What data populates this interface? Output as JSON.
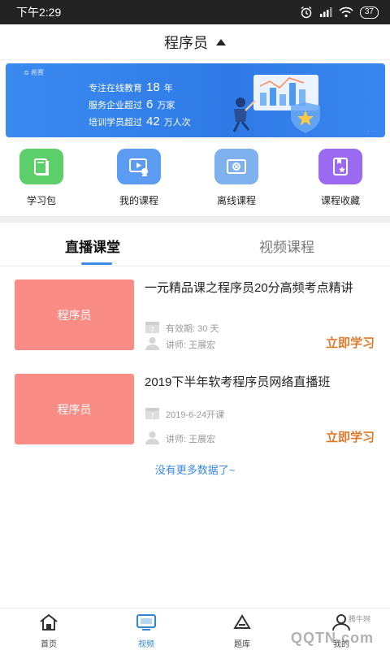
{
  "status_bar": {
    "time": "下午2:29",
    "battery": "37"
  },
  "header": {
    "title": "程序员"
  },
  "banner": {
    "logo": "希赛",
    "line1_prefix": "专注在线教育",
    "line1_num": "18",
    "line1_suffix": "年",
    "line2_prefix": "服务企业超过",
    "line2_num": "6",
    "line2_suffix": "万家",
    "line3_prefix": "培训学员超过",
    "line3_num": "42",
    "line3_suffix": "万人次"
  },
  "quick_links": [
    {
      "label": "学习包",
      "icon": "book-icon",
      "color": "#5ccf6a"
    },
    {
      "label": "我的课程",
      "icon": "play-screen-icon",
      "color": "#5b9cf2"
    },
    {
      "label": "离线课程",
      "icon": "offline-video-icon",
      "color": "#7fb1ee"
    },
    {
      "label": "课程收藏",
      "icon": "bookmark-star-icon",
      "color": "#9a6af0"
    }
  ],
  "tabs": {
    "live": "直播课堂",
    "video": "视频课程"
  },
  "courses": [
    {
      "thumb_label": "程序员",
      "title": "一元精品课之程序员20分高频考点精讲",
      "date_text": "有效期: 30 天",
      "teacher": "讲师: 王展宏",
      "action": "立即学习"
    },
    {
      "thumb_label": "程序员",
      "title": "2019下半年软考程序员网络直播班",
      "date_text": "2019-6-24开课",
      "teacher": "讲师: 王展宏",
      "action": "立即学习"
    }
  ],
  "no_more": "没有更多数据了~",
  "bottom_nav": [
    {
      "label": "首页",
      "icon": "home-icon"
    },
    {
      "label": "视频",
      "icon": "tv-icon"
    },
    {
      "label": "题库",
      "icon": "question-bank-icon"
    },
    {
      "label": "我的",
      "icon": "user-icon"
    }
  ],
  "watermark": {
    "main": "QQTN.com",
    "sub": "腾牛网"
  },
  "colors": {
    "accent": "#3a8ae6",
    "action": "#e0792b",
    "thumb": "#fa8c86"
  }
}
